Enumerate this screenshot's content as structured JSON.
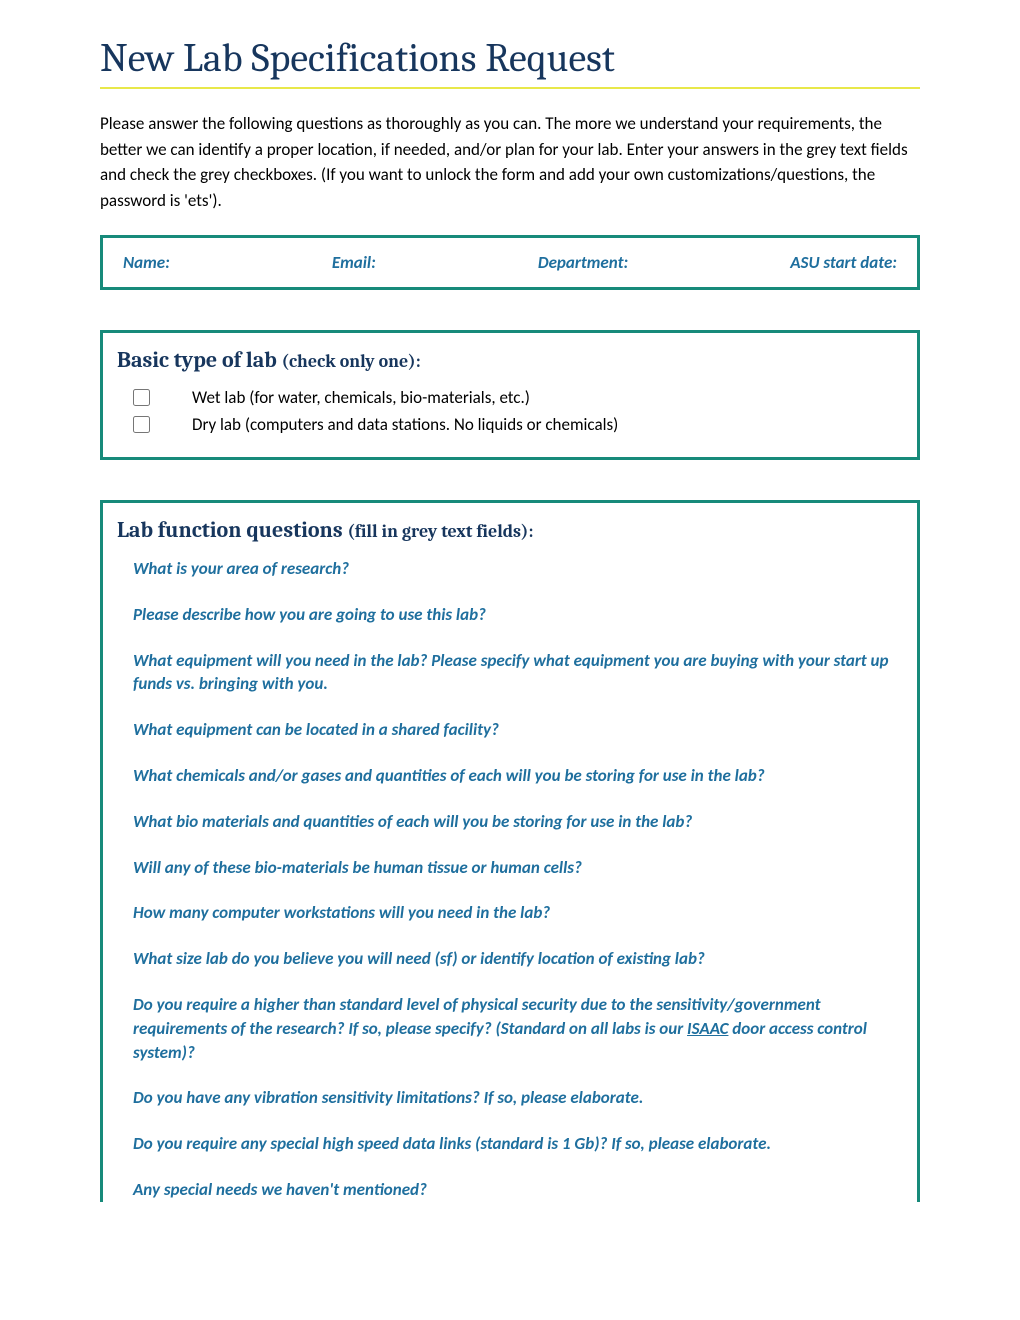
{
  "title": "New Lab Specifications Request",
  "intro": "Please answer the following questions as thoroughly as you can.  The more we understand your requirements, the better we can identify a proper location, if needed, and/or plan for your lab.  Enter your answers in the grey text fields and check the grey checkboxes.  (If you want to unlock the form and add your own customizations/questions, the password is 'ets').",
  "identity": {
    "name_label": "Name:",
    "email_label": "Email:",
    "department_label": "Department:",
    "start_date_label": "ASU start date:"
  },
  "lab_type": {
    "heading_main": "Basic type of lab ",
    "heading_sub": "(check only one):",
    "options": [
      "Wet lab (for water, chemicals, bio-materials, etc.)",
      "Dry lab (computers and data stations.  No liquids or chemicals)"
    ]
  },
  "lab_function": {
    "heading_main": "Lab function questions ",
    "heading_sub": "(fill in grey text fields):",
    "questions": [
      "What is your area of research?",
      "Please describe how you are going to use this lab?",
      "What equipment will you need in the lab?  Please specify what equipment you are buying with your start up funds vs. bringing with you.",
      "What equipment can be located in a shared facility?",
      "What chemicals and/or gases and quantities of each will you be storing for use in the lab?",
      "What bio materials and quantities of each will you be storing for use in the lab?",
      "Will any of these bio-materials be human tissue or human cells?",
      "How many computer workstations will you need in the lab?",
      "What size lab do you believe you will need (sf) or identify location of existing lab?"
    ],
    "security_q_pre": "Do you require a higher than standard level of physical security due to the sensitivity/government requirements of the research?  If so, please specify? (Standard on all labs is our ",
    "security_q_link": "ISAAC",
    "security_q_post": " door access control system)?",
    "questions_tail": [
      "Do you have any vibration sensitivity limitations?  If so, please elaborate.",
      "Do you require any special high speed data links (standard is 1 Gb)?  If so, please elaborate.",
      "Any special needs we haven't mentioned?"
    ]
  }
}
